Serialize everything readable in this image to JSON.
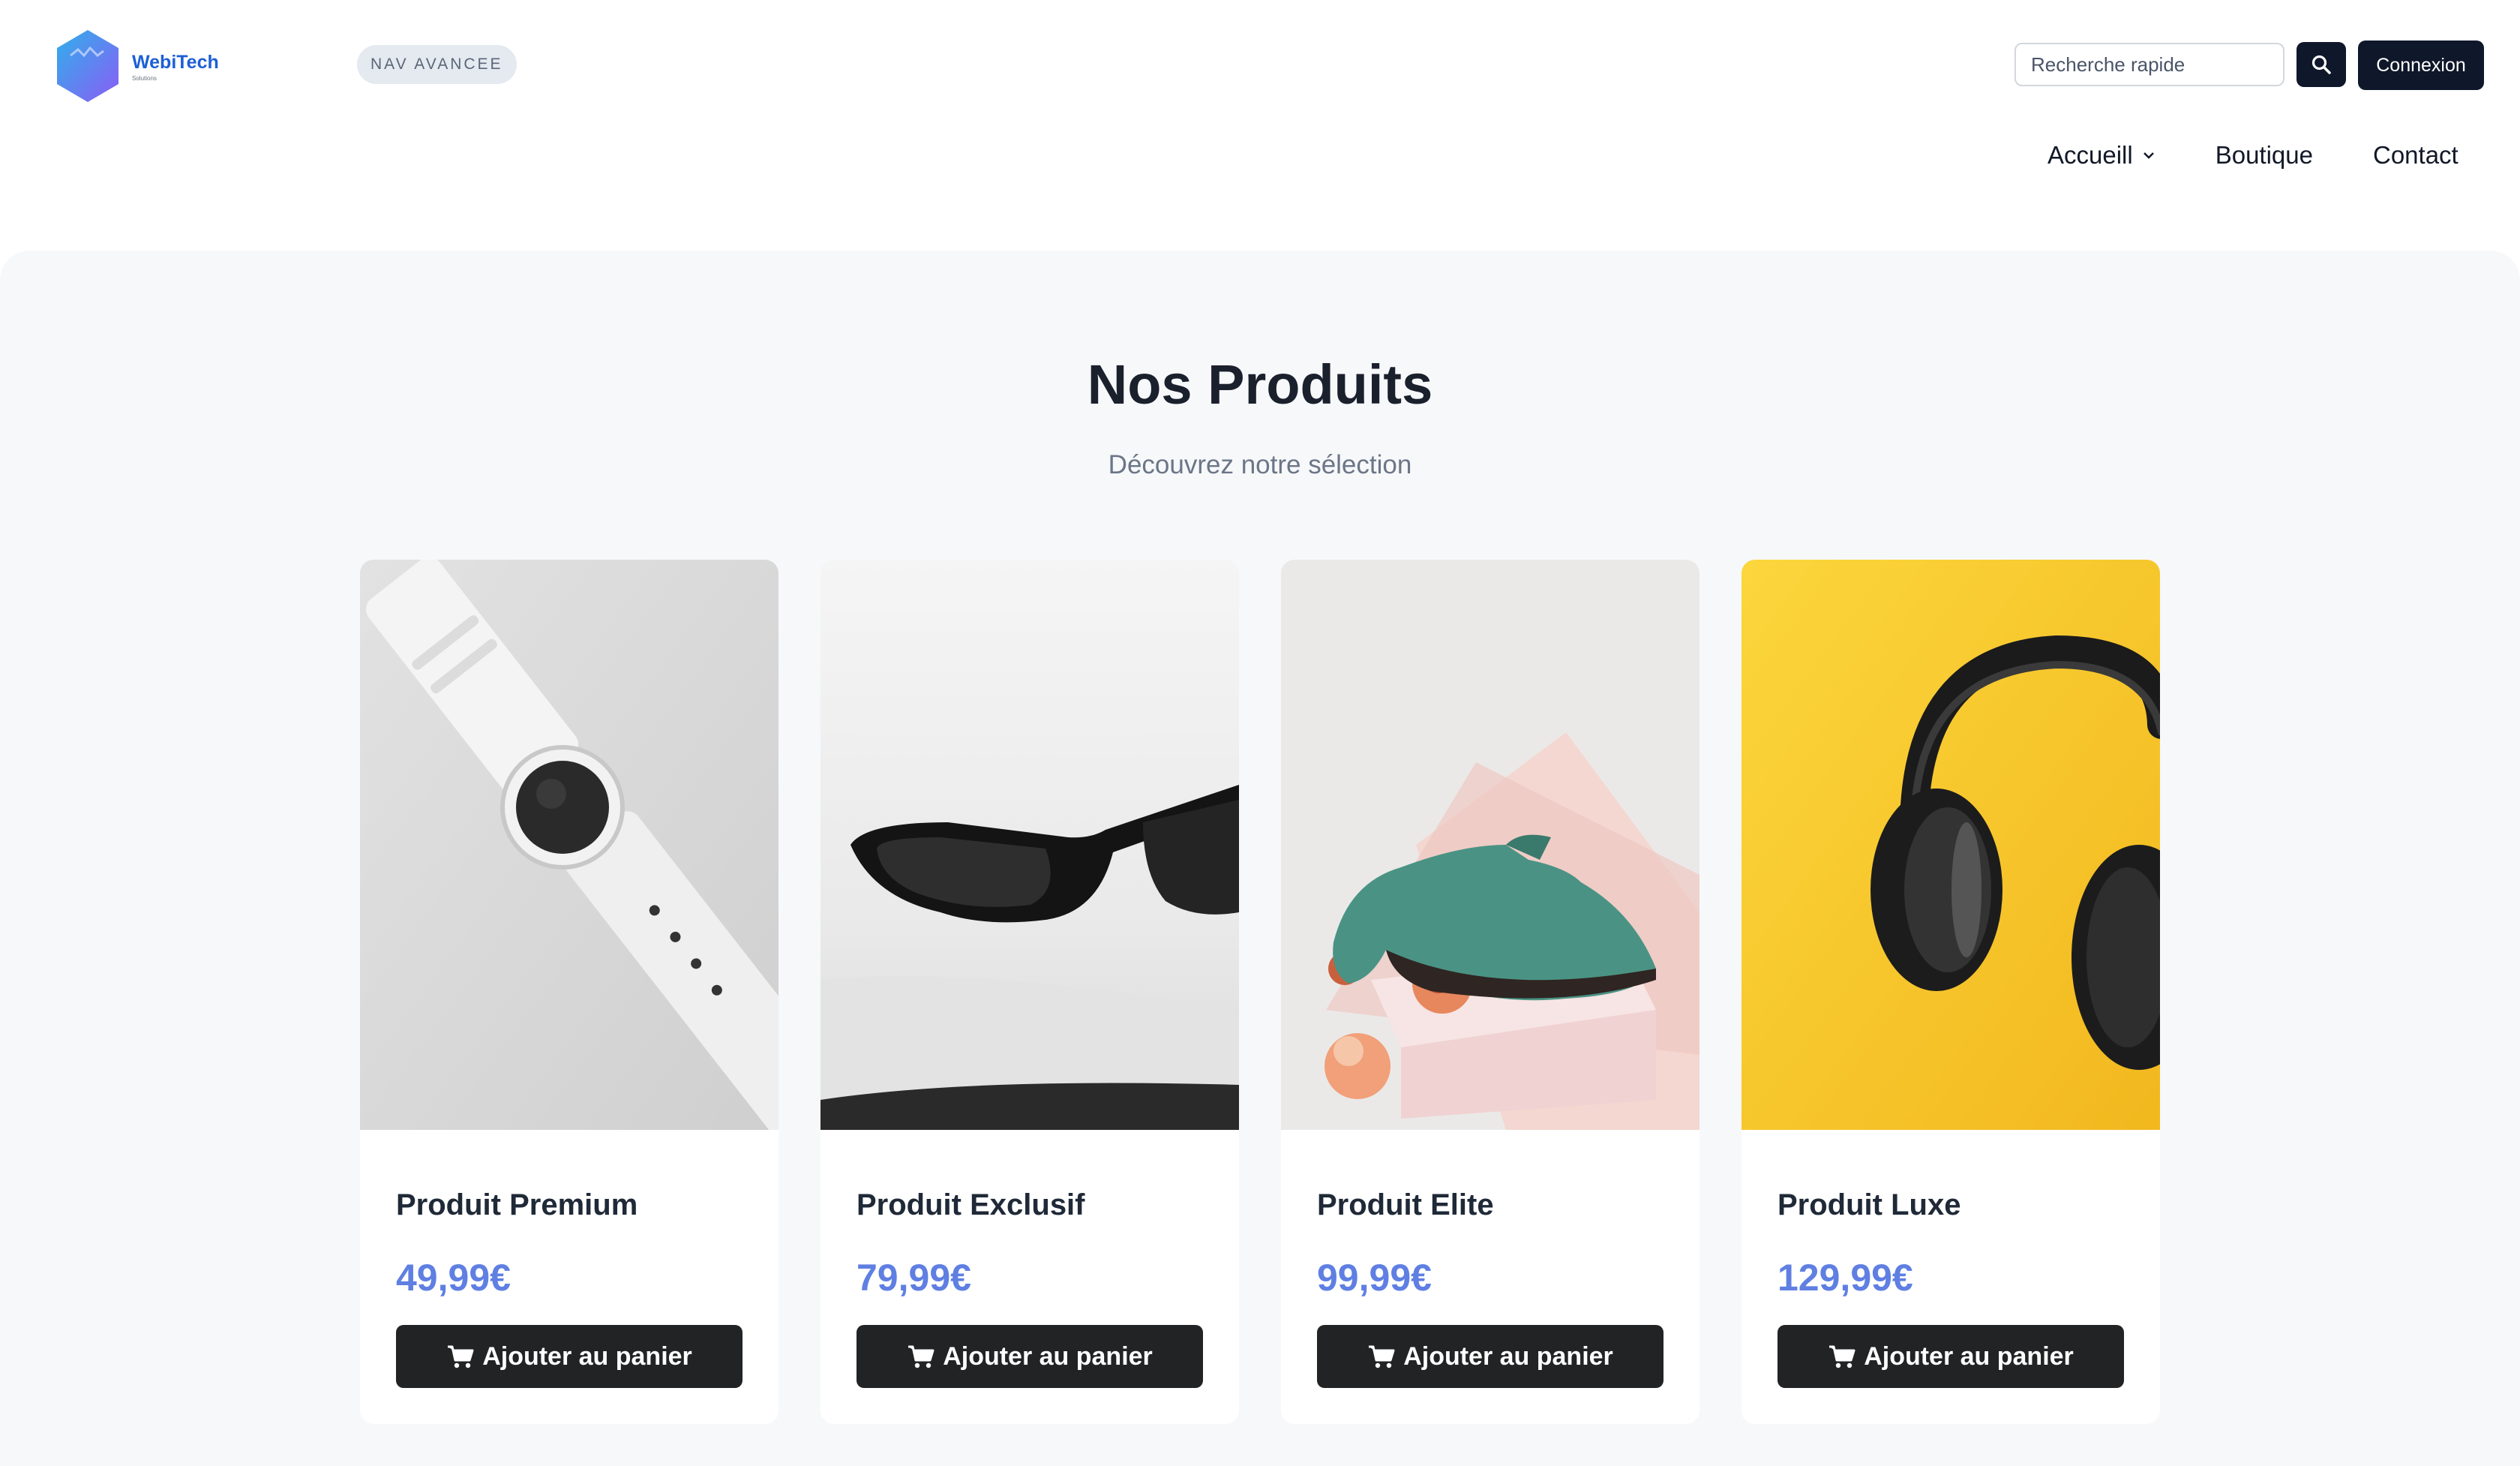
{
  "brand": {
    "name": "WebiTech",
    "tagline": "Solutions",
    "colors": {
      "primary": "#0f172a",
      "accent": "#5f7fe2",
      "hex_from": "#3aa0e8",
      "hex_to": "#8b5cf6"
    }
  },
  "header": {
    "badge": "NAV AVANCEE",
    "search": {
      "placeholder": "Recherche rapide",
      "value": "",
      "icon": "search-icon"
    },
    "login_label": "Connexion"
  },
  "nav": {
    "items": [
      {
        "label": "Accueill",
        "has_dropdown": true
      },
      {
        "label": "Boutique"
      },
      {
        "label": "Contact"
      }
    ]
  },
  "products": {
    "title": "Nos Produits",
    "subtitle": "Découvrez notre sélection",
    "items": [
      {
        "name": "Produit Premium",
        "price": "49,99€",
        "button": "Ajouter au panier",
        "image": "white-smartwatch"
      },
      {
        "name": "Produit Exclusif",
        "price": "79,99€",
        "button": "Ajouter au panier",
        "image": "black-sunglasses"
      },
      {
        "name": "Produit Elite",
        "price": "99,99€",
        "button": "Ajouter au panier",
        "image": "green-suede-shoe"
      },
      {
        "name": "Produit Luxe",
        "price": "129,99€",
        "button": "Ajouter au panier",
        "image": "black-headphones-yellow"
      }
    ]
  }
}
